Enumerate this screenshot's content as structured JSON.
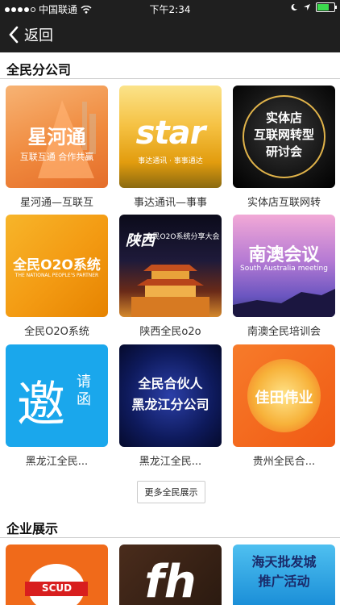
{
  "status_bar": {
    "carrier": "中国联通",
    "time": "下午2:34"
  },
  "nav": {
    "back_label": "返回"
  },
  "sections": [
    {
      "title": "全民分公司"
    },
    {
      "title": "企业展示"
    }
  ],
  "grid_items": [
    {
      "caption": "星河通—互联互",
      "tile_text": "星河通",
      "tile_sub": "互联互通 合作共赢"
    },
    {
      "caption": "事达通讯—事事",
      "tile_text": "star",
      "tile_sub": "事达通讯 · 事事通达"
    },
    {
      "caption": "实体店互联网转",
      "tile_text": "实体店\n互联网转型\n研讨会",
      "tile_sub": ""
    },
    {
      "caption": "全民O2O系统",
      "tile_text": "全民O2O系统",
      "tile_sub": "THE NATIONAL PEOPLE'S PARTNER"
    },
    {
      "caption": "陕西全民o2o",
      "tile_text": "陕西",
      "tile_sub": "全民O2O系统分享大会"
    },
    {
      "caption": "南澳全民培训会",
      "tile_text": "南澳会议",
      "tile_sub": "South Australia meeting"
    },
    {
      "caption": "黑龙江全民...",
      "tile_text": "邀",
      "tile_sub": "请函"
    },
    {
      "caption": "黑龙江全民...",
      "tile_text": "全民合伙人\n黑龙江分公司",
      "tile_sub": ""
    },
    {
      "caption": "贵州全民合...",
      "tile_text": "佳田伟业",
      "tile_sub": ""
    }
  ],
  "more_button": "更多全民展示",
  "enterprise_items": [
    {
      "tile_text": "SCUD"
    },
    {
      "tile_text": "fh"
    },
    {
      "tile_text": "海天批发城\n推广活动"
    }
  ],
  "colors": {
    "bar": "#1f1f1f",
    "battery": "#3cdb4e"
  }
}
